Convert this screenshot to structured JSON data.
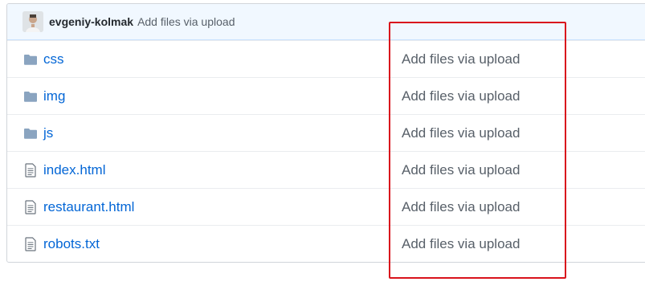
{
  "commit": {
    "author": "evgeniy-kolmak",
    "message": "Add files via upload"
  },
  "files": [
    {
      "name": "css",
      "type": "folder",
      "icon": "folder-icon",
      "commit_message": "Add files via upload"
    },
    {
      "name": "img",
      "type": "folder",
      "icon": "folder-icon",
      "commit_message": "Add files via upload"
    },
    {
      "name": "js",
      "type": "folder",
      "icon": "folder-icon",
      "commit_message": "Add files via upload"
    },
    {
      "name": "index.html",
      "type": "file",
      "icon": "file-icon",
      "commit_message": "Add files via upload"
    },
    {
      "name": "restaurant.html",
      "type": "file",
      "icon": "file-icon",
      "commit_message": "Add files via upload"
    },
    {
      "name": "robots.txt",
      "type": "file",
      "icon": "file-icon",
      "commit_message": "Add files via upload"
    }
  ],
  "colors": {
    "link": "#0366d6",
    "muted_text": "#586069",
    "commit_bar_bg": "#f1f8ff",
    "folder_icon": "#79b8ff",
    "file_icon": "#6a737d",
    "highlight_border": "#d9131c"
  }
}
